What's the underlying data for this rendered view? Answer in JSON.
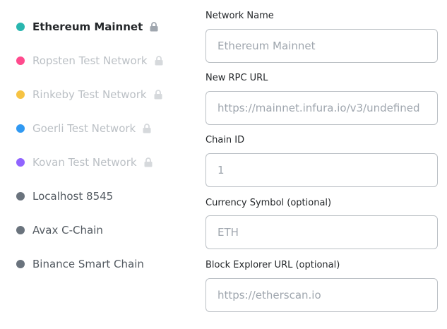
{
  "networks": [
    {
      "label": "Ethereum Mainnet",
      "color": "#29b6af",
      "state": "selected",
      "locked": true
    },
    {
      "label": "Ropsten Test Network",
      "color": "#ff4a8d",
      "state": "locked",
      "locked": true
    },
    {
      "label": "Rinkeby Test Network",
      "color": "#f6c343",
      "state": "locked",
      "locked": true
    },
    {
      "label": "Goerli Test Network",
      "color": "#3099f2",
      "state": "locked",
      "locked": true
    },
    {
      "label": "Kovan Test Network",
      "color": "#9064ff",
      "state": "locked",
      "locked": true
    },
    {
      "label": "Localhost 8545",
      "color": "#6a737d",
      "state": "custom",
      "locked": false
    },
    {
      "label": "Avax C-Chain",
      "color": "#6a737d",
      "state": "custom",
      "locked": false
    },
    {
      "label": "Binance Smart Chain",
      "color": "#6a737d",
      "state": "custom",
      "locked": false
    }
  ],
  "form": {
    "network_name": {
      "label": "Network Name",
      "value": "Ethereum Mainnet"
    },
    "rpc_url": {
      "label": "New RPC URL",
      "value": "https://mainnet.infura.io/v3/undefined"
    },
    "chain_id": {
      "label": "Chain ID",
      "value": "1"
    },
    "currency_symbol": {
      "label": "Currency Symbol (optional)",
      "value": "ETH"
    },
    "block_explorer": {
      "label": "Block Explorer URL (optional)",
      "value": "https://etherscan.io"
    }
  },
  "colors": {
    "lock_selected": "#9fa6ae",
    "lock_muted": "#d6d9dc",
    "input_border": "#bbc0c5",
    "input_text": "#9fa6ae"
  }
}
